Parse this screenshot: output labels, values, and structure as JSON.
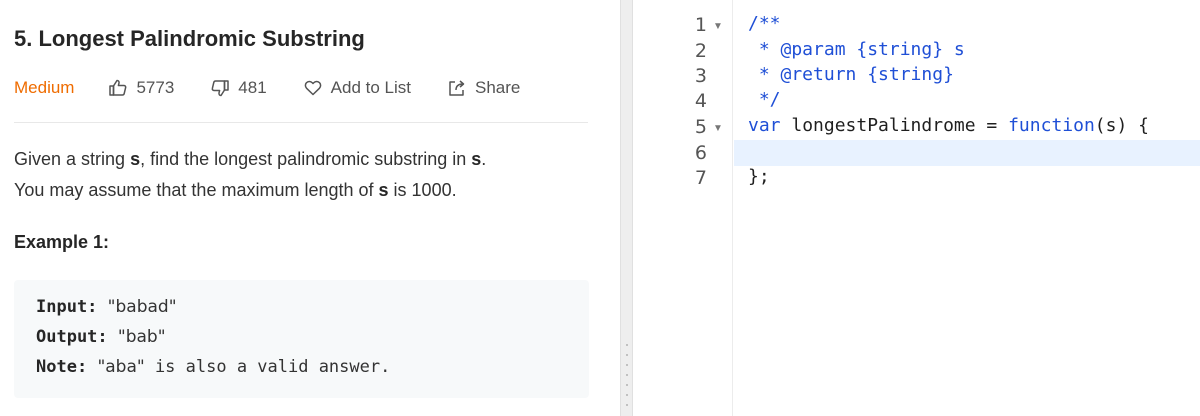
{
  "problem": {
    "title": "5. Longest Palindromic Substring",
    "difficulty": "Medium",
    "likes": "5773",
    "dislikes": "481",
    "add_to_list": "Add to List",
    "share": "Share",
    "p1_prefix": "Given a string ",
    "var_s": "s",
    "p1_suffix": ", find the longest palindromic substring in ",
    "p1_end": ".",
    "p2_prefix": "You may assume that the maximum length of ",
    "p2_suffix": " is 1000.",
    "example_title": "Example 1:",
    "example": {
      "input_label": "Input:",
      "input_value": "\"babad\"",
      "output_label": "Output:",
      "output_value": "\"bab\"",
      "note_label": "Note:",
      "note_value_q": "\"aba\"",
      "note_value_rest": " is also a valid answer."
    }
  },
  "editor": {
    "line_numbers": [
      "1",
      "2",
      "3",
      "4",
      "5",
      "6",
      "7"
    ],
    "lines": {
      "l1": "/**",
      "l2": " * @param {string} s",
      "l3": " * @return {string}",
      "l4": " */",
      "l5_kw": "var",
      "l5_name": " longestPalindrome = ",
      "l5_fn": "function",
      "l5_rest": "(s) {",
      "l7": "};"
    }
  },
  "colors": {
    "difficulty_medium": "#ef6c00",
    "code_keyword": "#1f4fd6",
    "active_line": "#e8f2ff"
  },
  "icons": [
    "thumbs-up-icon",
    "thumbs-down-icon",
    "heart-icon",
    "share-icon",
    "fold-arrow-icon"
  ]
}
